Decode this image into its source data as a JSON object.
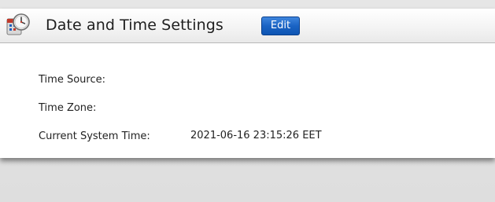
{
  "panel": {
    "title": "Date and Time Settings",
    "icon": "calendar-clock-icon",
    "edit_label": "Edit"
  },
  "settings": {
    "time_source_label": "Time Source:",
    "time_source_value": "",
    "time_zone_label": "Time Zone:",
    "time_zone_value": "",
    "current_time_label": "Current System Time:",
    "current_time_value": "2021-06-16 23:15:26 EET"
  },
  "colors": {
    "accent": "#1a63c4",
    "header_bg": "#f4f4f4",
    "page_bg": "#e2e2e2"
  }
}
